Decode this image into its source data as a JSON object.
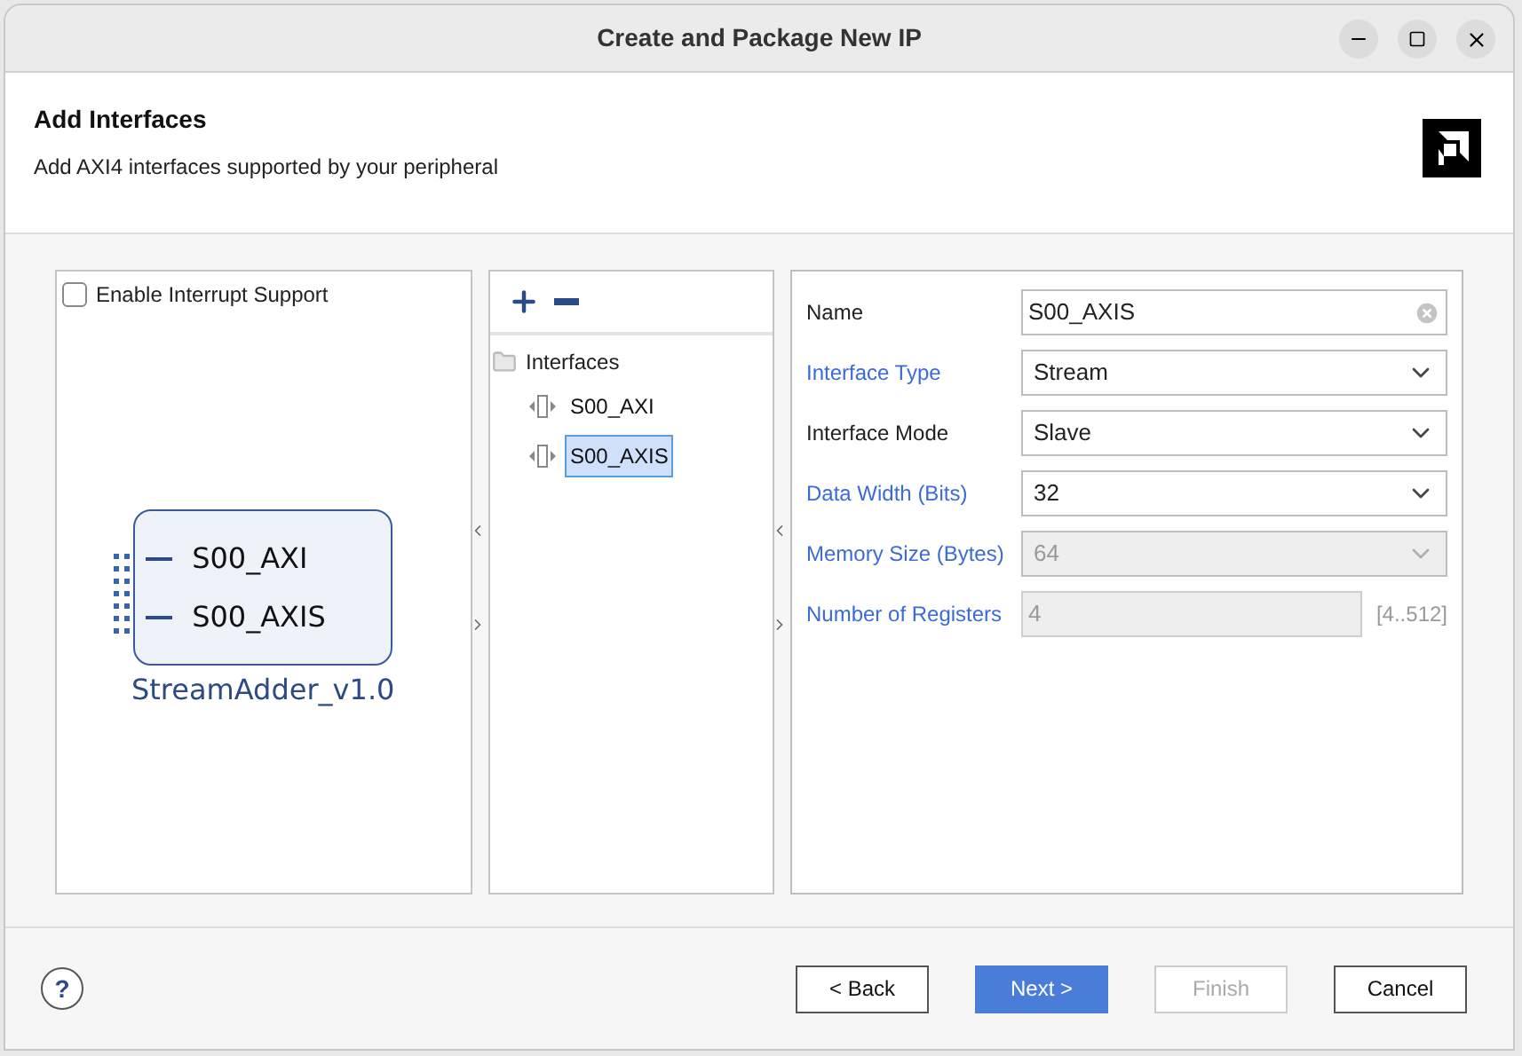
{
  "window": {
    "title": "Create and Package New IP"
  },
  "header": {
    "title": "Add Interfaces",
    "subtitle": "Add AXI4 interfaces supported by your peripheral"
  },
  "interrupt": {
    "label": "Enable Interrupt Support",
    "checked": false
  },
  "block": {
    "ports": [
      "S00_AXI",
      "S00_AXIS"
    ],
    "name": "StreamAdder_v1.0"
  },
  "tree": {
    "root": "Interfaces",
    "expanded": true,
    "children": [
      {
        "label": "S00_AXI",
        "selected": false
      },
      {
        "label": "S00_AXIS",
        "selected": true
      }
    ]
  },
  "fields": [
    {
      "label": "Name",
      "kind": "text",
      "value": "S00_AXIS",
      "highlighted": false
    },
    {
      "label": "Interface Type",
      "kind": "select",
      "value": "Stream",
      "highlighted": true,
      "disabled": false
    },
    {
      "label": "Interface Mode",
      "kind": "select",
      "value": "Slave",
      "highlighted": false,
      "disabled": false
    },
    {
      "label": "Data Width (Bits)",
      "kind": "select",
      "value": "32",
      "highlighted": true,
      "disabled": false
    },
    {
      "label": "Memory Size (Bytes)",
      "kind": "select",
      "value": "64",
      "highlighted": true,
      "disabled": true
    },
    {
      "label": "Number of Registers",
      "kind": "number",
      "value": "4",
      "range": "[4..512]",
      "highlighted": true,
      "disabled": true
    }
  ],
  "help": "?",
  "buttons": [
    {
      "label": "< Back",
      "kind": "normal",
      "disabled": false
    },
    {
      "label": "Next >",
      "kind": "primary",
      "disabled": false
    },
    {
      "label": "Finish",
      "kind": "normal",
      "disabled": true
    },
    {
      "label": "Cancel",
      "kind": "normal",
      "disabled": false
    }
  ]
}
